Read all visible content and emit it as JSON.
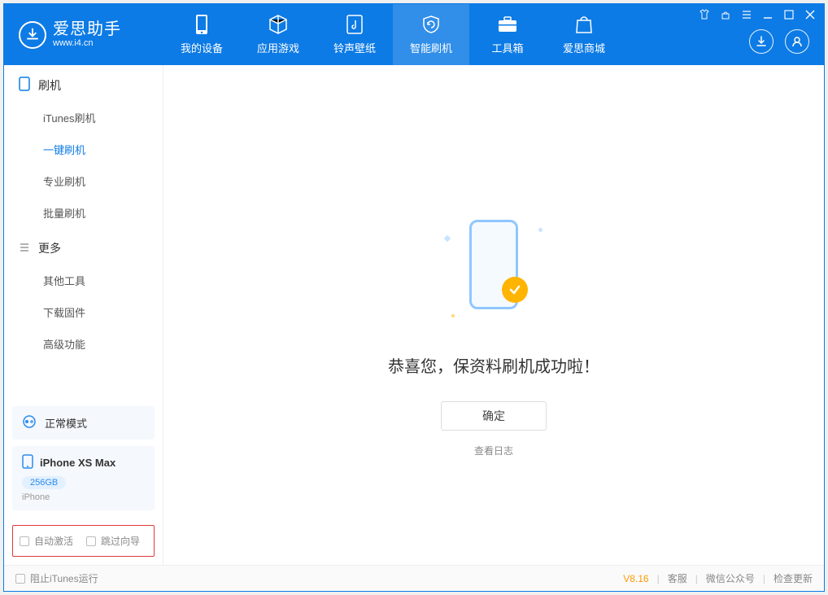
{
  "app": {
    "name_cn": "爱思助手",
    "name_en": "www.i4.cn"
  },
  "nav": {
    "items": [
      {
        "label": "我的设备"
      },
      {
        "label": "应用游戏"
      },
      {
        "label": "铃声壁纸"
      },
      {
        "label": "智能刷机"
      },
      {
        "label": "工具箱"
      },
      {
        "label": "爱思商城"
      }
    ]
  },
  "sidebar": {
    "section1": {
      "title": "刷机",
      "items": [
        {
          "label": "iTunes刷机"
        },
        {
          "label": "一键刷机"
        },
        {
          "label": "专业刷机"
        },
        {
          "label": "批量刷机"
        }
      ]
    },
    "section2": {
      "title": "更多",
      "items": [
        {
          "label": "其他工具"
        },
        {
          "label": "下载固件"
        },
        {
          "label": "高级功能"
        }
      ]
    },
    "mode_card": {
      "label": "正常模式"
    },
    "device_card": {
      "name": "iPhone XS Max",
      "storage": "256GB",
      "type": "iPhone"
    },
    "checkboxes": {
      "auto_activate": "自动激活",
      "skip_guide": "跳过向导"
    }
  },
  "main": {
    "success_text": "恭喜您，保资料刷机成功啦！",
    "ok_label": "确定",
    "log_link": "查看日志"
  },
  "status": {
    "block_itunes": "阻止iTunes运行",
    "version": "V8.16",
    "links": {
      "support": "客服",
      "wechat": "微信公众号",
      "update": "检查更新"
    }
  }
}
